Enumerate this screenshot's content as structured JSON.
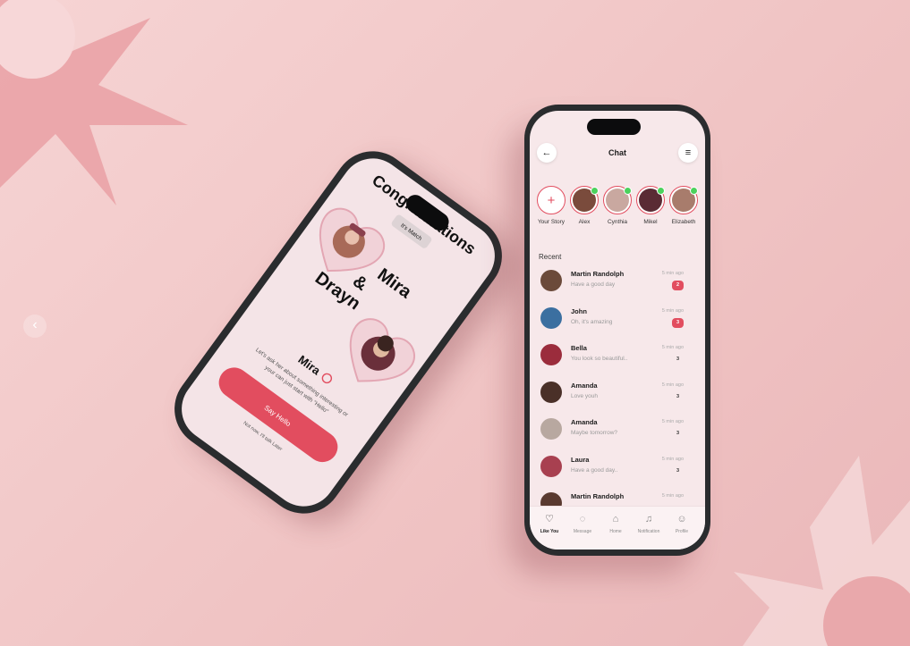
{
  "colors": {
    "accent": "#e24d5f",
    "background": "#f3cfd0",
    "online": "#4bd15c"
  },
  "carousel": {
    "prev_icon": "chevron-left-icon",
    "prev_label": "‹"
  },
  "match_screen": {
    "title": "Congratulations",
    "badge": "It's Match",
    "name_line1": "Mira",
    "name_ampersand": "&",
    "name_line2": "Drayn",
    "profile_name": "Mira",
    "verified_icon": "verified-badge-icon",
    "prompt": "Let's ask her about something interesting or your can just start with \"Hello\"",
    "primary_button": "Say Hello",
    "secondary_link": "Not now, I'll talk Later"
  },
  "chat_screen": {
    "title": "Chat",
    "back_icon": "←",
    "menu_icon": "≡",
    "stories": [
      {
        "label": "Your Story",
        "add": "+"
      },
      {
        "label": "Alex",
        "color": "#7a4b3c"
      },
      {
        "label": "Cynthia",
        "color": "#c9a8a0"
      },
      {
        "label": "Mikel",
        "color": "#5a2b34"
      },
      {
        "label": "Elizabeth",
        "color": "#a87c6c"
      }
    ],
    "recent_label": "Recent",
    "messages": [
      {
        "name": "Martin Randolph",
        "text": "Have a good day",
        "time": "5 min ago",
        "count": "2",
        "unread": true,
        "color": "#6b4a3a"
      },
      {
        "name": "John",
        "text": "Oh, it's amazing",
        "time": "5 min ago",
        "count": "3",
        "unread": true,
        "color": "#3b6fa0"
      },
      {
        "name": "Bella",
        "text": "You look so beautiful..",
        "time": "5 min ago",
        "count": "3",
        "unread": false,
        "color": "#9b2c3c"
      },
      {
        "name": "Amanda",
        "text": "Love youh",
        "time": "5 min ago",
        "count": "3",
        "unread": false,
        "color": "#4a3028"
      },
      {
        "name": "Amanda",
        "text": "Maybe tomorrow?",
        "time": "5 min ago",
        "count": "3",
        "unread": false,
        "color": "#b8a8a0"
      },
      {
        "name": "Laura",
        "text": "Have a good day..",
        "time": "5 min ago",
        "count": "3",
        "unread": false,
        "color": "#a84050"
      },
      {
        "name": "Martin Randolph",
        "text": "",
        "time": "5 min ago",
        "count": "",
        "unread": false,
        "color": "#5a3a30"
      }
    ],
    "tabs": [
      {
        "label": "Like You",
        "icon": "♡",
        "active": true
      },
      {
        "label": "Message",
        "icon": "◌",
        "active": false
      },
      {
        "label": "Home",
        "icon": "⌂",
        "active": false
      },
      {
        "label": "Notification",
        "icon": "♫",
        "active": false
      },
      {
        "label": "Profile",
        "icon": "☺",
        "active": false
      }
    ]
  }
}
